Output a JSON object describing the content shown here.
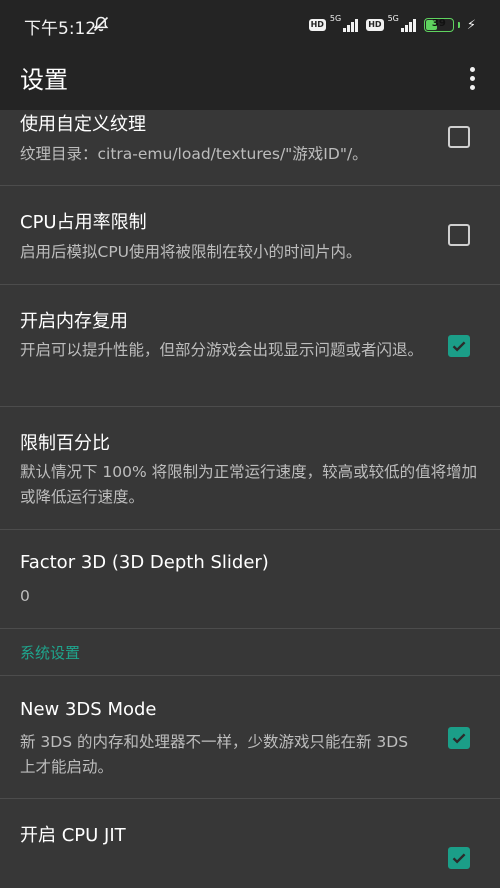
{
  "status_bar": {
    "time": "下午5:12",
    "mute_icon": "bell-slash-icon",
    "sim1_badge": "HD",
    "sim1_network": "5G",
    "sim2_badge": "HD",
    "sim2_network": "5G",
    "battery_level": "39",
    "charging_icon": "bolt-icon",
    "battery_color": "#5fd35f"
  },
  "app_bar": {
    "title": "设置",
    "overflow_icon": "more-vert-icon"
  },
  "accent_color": "#1b9e88",
  "settings": [
    {
      "title": "使用自定义纹理",
      "summary": "纹理目录：citra-emu/load/textures/\"游戏ID\"/。",
      "checked": false
    },
    {
      "title": "CPU占用率限制",
      "summary": "启用后模拟CPU使用将被限制在较小的时间片内。",
      "checked": false
    },
    {
      "title": "开启内存复用",
      "summary": "开启可以提升性能，但部分游戏会出现显示问题或者闪退。",
      "checked": true
    },
    {
      "title": "限制百分比",
      "summary": "默认情况下 100% 将限制为正常运行速度，较高或较低的值将增加或降低运行速度。"
    },
    {
      "title": "Factor 3D (3D Depth Slider)",
      "summary": "0"
    }
  ],
  "section_header": "系统设置",
  "system_settings": [
    {
      "title": "New 3DS Mode",
      "summary": "新 3DS 的内存和处理器不一样，少数游戏只能在新 3DS 上才能启动。",
      "checked": true
    },
    {
      "title": "开启 CPU JIT",
      "checked": true
    }
  ]
}
